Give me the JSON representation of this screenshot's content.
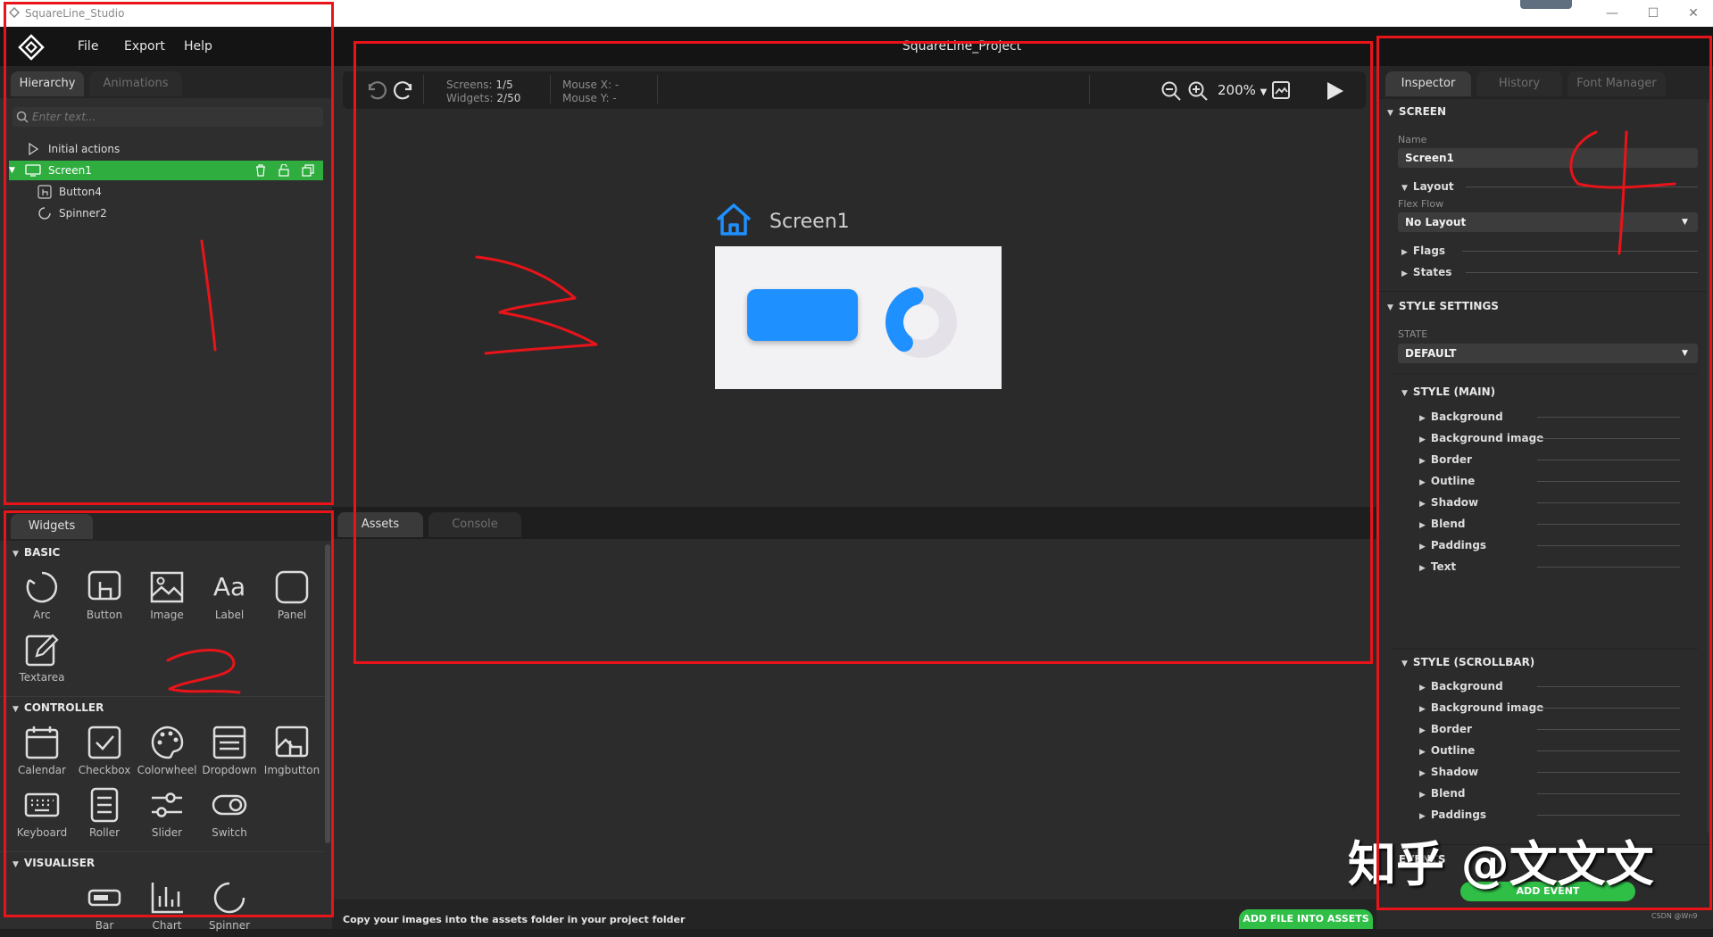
{
  "window": {
    "title": "SquareLine_Studio",
    "minimize_glyph": "—",
    "maximize_glyph": "☐",
    "close_glyph": "✕"
  },
  "menu": [
    "File",
    "Export",
    "Help"
  ],
  "project_title": "SquareLine_Project",
  "hierarchy": {
    "tabs": [
      "Hierarchy",
      "Animations"
    ],
    "search_placeholder": "Enter text...",
    "items": [
      "Initial actions",
      "Screen1",
      "Button4",
      "Spinner2"
    ]
  },
  "toolbar": {
    "screens_label": "Screens:",
    "screens_value": "1/5",
    "widgets_label": "Widgets:",
    "widgets_value": "2/50",
    "mouse_x": "Mouse X: -",
    "mouse_y": "Mouse Y: -",
    "zoom": "200%"
  },
  "canvas": {
    "screen_name": "Screen1",
    "accent": "#1e90ff",
    "spinner_progress": 0.35
  },
  "widgets_panel": {
    "tab": "Widgets",
    "sections": [
      {
        "title": "BASIC",
        "items": [
          {
            "label": "Arc",
            "icon": "arc-icon"
          },
          {
            "label": "Button",
            "icon": "button-icon"
          },
          {
            "label": "Image",
            "icon": "image-icon"
          },
          {
            "label": "Label",
            "icon": "label-icon",
            "glyph": "Aa"
          },
          {
            "label": "Panel",
            "icon": "panel-icon"
          },
          {
            "label": "Textarea",
            "icon": "textarea-icon"
          }
        ]
      },
      {
        "title": "CONTROLLER",
        "items": [
          {
            "label": "Calendar",
            "icon": "calendar-icon"
          },
          {
            "label": "Checkbox",
            "icon": "checkbox-icon"
          },
          {
            "label": "Colorwheel",
            "icon": "colorwheel-icon"
          },
          {
            "label": "Dropdown",
            "icon": "dropdown-icon"
          },
          {
            "label": "Imgbutton",
            "icon": "imgbutton-icon"
          },
          {
            "label": "Keyboard",
            "icon": "keyboard-icon"
          },
          {
            "label": "Roller",
            "icon": "roller-icon"
          },
          {
            "label": "Slider",
            "icon": "slider-icon"
          },
          {
            "label": "Switch",
            "icon": "switch-icon"
          }
        ]
      },
      {
        "title": "VISUALISER",
        "items": [
          {
            "label": "Bar",
            "icon": "bar-icon"
          },
          {
            "label": "Chart",
            "icon": "chart-icon"
          },
          {
            "label": "Spinner",
            "icon": "spinner-icon"
          }
        ]
      }
    ]
  },
  "assets": {
    "tabs": [
      "Assets",
      "Console"
    ],
    "hint": "Copy your images into the assets folder in your project folder",
    "add_button": "ADD FILE INTO ASSETS"
  },
  "inspector": {
    "tabs": [
      "Inspector",
      "History",
      "Font Manager"
    ],
    "screen_section": "SCREEN",
    "name_label": "Name",
    "name_value": "Screen1",
    "layout_label": "Layout",
    "flex_flow_label": "Flex Flow",
    "flex_flow_value": "No Layout",
    "flags_label": "Flags",
    "states_label": "States",
    "style_settings": "STYLE SETTINGS",
    "state_label": "STATE",
    "state_value": "DEFAULT",
    "style_main": "STYLE (MAIN)",
    "style_main_items": [
      "Background",
      "Background image",
      "Border",
      "Outline",
      "Shadow",
      "Blend",
      "Paddings",
      "Text"
    ],
    "style_scrollbar": "STYLE (SCROLLBAR)",
    "style_scrollbar_items": [
      "Background",
      "Background image",
      "Border",
      "Outline",
      "Shadow",
      "Blend",
      "Paddings"
    ],
    "events": "EVENTS",
    "add_event": "ADD EVENT"
  },
  "watermark": {
    "text": "知乎 @文文文",
    "small": "CSDN @Wn9"
  },
  "colors": {
    "selected_row": "#2fae3f",
    "green_button": "#2fbf47",
    "annotation_red": "#e8141a"
  }
}
